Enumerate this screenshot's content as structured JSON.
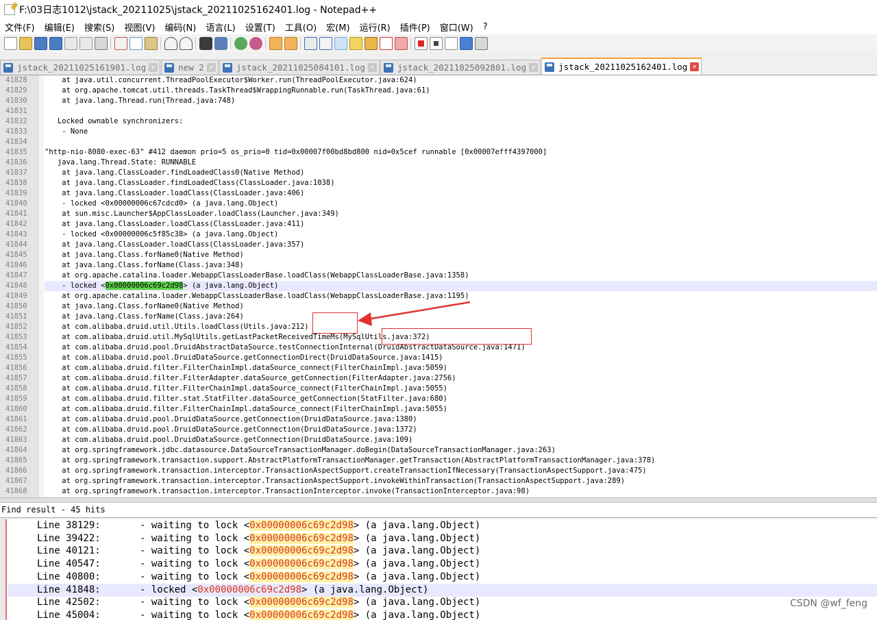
{
  "window": {
    "title": "F:\\03日志1012\\jstack_20211025\\jstack_20211025162401.log - Notepad++"
  },
  "menu": [
    "文件(F)",
    "编辑(E)",
    "搜索(S)",
    "视图(V)",
    "编码(N)",
    "语言(L)",
    "设置(T)",
    "工具(O)",
    "宏(M)",
    "运行(R)",
    "插件(P)",
    "窗口(W)",
    "?"
  ],
  "toolbar": [
    "new-file-icon",
    "open-file-icon",
    "save-icon",
    "save-all-icon",
    "close-icon",
    "close-all-icon",
    "print-icon",
    "sep",
    "cut-icon",
    "copy-icon",
    "paste-icon",
    "sep",
    "undo-icon",
    "redo-icon",
    "sep",
    "find-icon",
    "replace-icon",
    "sep",
    "zoom-in-icon",
    "zoom-out-icon",
    "sep",
    "sync-vertical-icon",
    "sync-horizontal-icon",
    "sep",
    "word-wrap-icon",
    "show-all-chars-icon",
    "indent-guide-icon",
    "doc-map-icon",
    "function-list-icon",
    "folder-workspace-icon",
    "monitor-icon",
    "sep",
    "record-macro-icon",
    "stop-record-icon",
    "play-macro-icon",
    "run-macro-multiple-icon",
    "save-macro-icon"
  ],
  "tabs": [
    {
      "label": "jstack_20211025161901.log",
      "active": false
    },
    {
      "label": "new 2",
      "active": false
    },
    {
      "label": "jstack_20211025084101.log",
      "active": false
    },
    {
      "label": "jstack_20211025092801.log",
      "active": false
    },
    {
      "label": "jstack_20211025162401.log",
      "active": true
    }
  ],
  "editor": {
    "lines": [
      {
        "n": "41828",
        "t": "    at java.util.concurrent.ThreadPoolExecutor$Worker.run(ThreadPoolExecutor.java:624)"
      },
      {
        "n": "41829",
        "t": "    at org.apache.tomcat.util.threads.TaskThread$WrappingRunnable.run(TaskThread.java:61)"
      },
      {
        "n": "41830",
        "t": "    at java.lang.Thread.run(Thread.java:748)"
      },
      {
        "n": "41831",
        "t": ""
      },
      {
        "n": "41832",
        "t": "   Locked ownable synchronizers:"
      },
      {
        "n": "41833",
        "t": "    - None"
      },
      {
        "n": "41834",
        "t": ""
      },
      {
        "n": "41835",
        "t": "\"http-nio-8080-exec-63\" #412 daemon prio=5 os_prio=0 tid=0x00007f00bd8bd800 nid=0x5cef runnable [0x00007efff4397000]"
      },
      {
        "n": "41836",
        "t": "   java.lang.Thread.State: RUNNABLE"
      },
      {
        "n": "41837",
        "t": "    at java.lang.ClassLoader.findLoadedClass0(Native Method)"
      },
      {
        "n": "41838",
        "t": "    at java.lang.ClassLoader.findLoadedClass(ClassLoader.java:1038)"
      },
      {
        "n": "41839",
        "t": "    at java.lang.ClassLoader.loadClass(ClassLoader.java:406)"
      },
      {
        "n": "41840",
        "t": "    - locked <0x00000006c67cdcd0> (a java.lang.Object)"
      },
      {
        "n": "41841",
        "t": "    at sun.misc.Launcher$AppClassLoader.loadClass(Launcher.java:349)"
      },
      {
        "n": "41842",
        "t": "    at java.lang.ClassLoader.loadClass(ClassLoader.java:411)"
      },
      {
        "n": "41843",
        "t": "    - locked <0x00000006c5f85c38> (a java.lang.Object)"
      },
      {
        "n": "41844",
        "t": "    at java.lang.ClassLoader.loadClass(ClassLoader.java:357)"
      },
      {
        "n": "41845",
        "t": "    at java.lang.Class.forName0(Native Method)"
      },
      {
        "n": "41846",
        "t": "    at java.lang.Class.forName(Class.java:348)"
      },
      {
        "n": "41847",
        "t": "    at org.apache.catalina.loader.WebappClassLoaderBase.loadClass(WebappClassLoaderBase.java:1358)"
      },
      {
        "n": "41848",
        "t_pre": "    - locked <",
        "t_mark": "0x00000006c69c2d98",
        "t_post": "> (a java.lang.Object)",
        "highlight": true
      },
      {
        "n": "41849",
        "t": "    at org.apache.catalina.loader.WebappClassLoaderBase.loadClass(WebappClassLoaderBase.java:1195)"
      },
      {
        "n": "41850",
        "t": "    at java.lang.Class.forName0(Native Method)"
      },
      {
        "n": "41851",
        "t": "    at java.lang.Class.forName(Class.java:264)"
      },
      {
        "n": "41852",
        "t": "    at com.alibaba.druid.util.Utils.loadClass(Utils.java:212)"
      },
      {
        "n": "41853",
        "t": "    at com.alibaba.druid.util.MySqlUtils.getLastPacketReceivedTimeMs(MySqlUtils.java:372)"
      },
      {
        "n": "41854",
        "t": "    at com.alibaba.druid.pool.DruidAbstractDataSource.testConnectionInternal(DruidAbstractDataSource.java:1471)"
      },
      {
        "n": "41855",
        "t": "    at com.alibaba.druid.pool.DruidDataSource.getConnectionDirect(DruidDataSource.java:1415)"
      },
      {
        "n": "41856",
        "t": "    at com.alibaba.druid.filter.FilterChainImpl.dataSource_connect(FilterChainImpl.java:5059)"
      },
      {
        "n": "41857",
        "t": "    at com.alibaba.druid.filter.FilterAdapter.dataSource_getConnection(FilterAdapter.java:2756)"
      },
      {
        "n": "41858",
        "t": "    at com.alibaba.druid.filter.FilterChainImpl.dataSource_connect(FilterChainImpl.java:5055)"
      },
      {
        "n": "41859",
        "t": "    at com.alibaba.druid.filter.stat.StatFilter.dataSource_getConnection(StatFilter.java:680)"
      },
      {
        "n": "41860",
        "t": "    at com.alibaba.druid.filter.FilterChainImpl.dataSource_connect(FilterChainImpl.java:5055)"
      },
      {
        "n": "41861",
        "t": "    at com.alibaba.druid.pool.DruidDataSource.getConnection(DruidDataSource.java:1380)"
      },
      {
        "n": "41862",
        "t": "    at com.alibaba.druid.pool.DruidDataSource.getConnection(DruidDataSource.java:1372)"
      },
      {
        "n": "41863",
        "t": "    at com.alibaba.druid.pool.DruidDataSource.getConnection(DruidDataSource.java:109)"
      },
      {
        "n": "41864",
        "t": "    at org.springframework.jdbc.datasource.DataSourceTransactionManager.doBegin(DataSourceTransactionManager.java:263)"
      },
      {
        "n": "41865",
        "t": "    at org.springframework.transaction.support.AbstractPlatformTransactionManager.getTransaction(AbstractPlatformTransactionManager.java:378)"
      },
      {
        "n": "41866",
        "t": "    at org.springframework.transaction.interceptor.TransactionAspectSupport.createTransactionIfNecessary(TransactionAspectSupport.java:475)"
      },
      {
        "n": "41867",
        "t": "    at org.springframework.transaction.interceptor.TransactionAspectSupport.invokeWithinTransaction(TransactionAspectSupport.java:289)"
      },
      {
        "n": "41868",
        "t": "    at org.springframework.transaction.interceptor.TransactionInterceptor.invoke(TransactionInterceptor.java:98)"
      }
    ]
  },
  "find_result": {
    "header": "Find result - 45 hits",
    "rows": [
      {
        "line": "Line 38129:",
        "pre": "- waiting to lock <",
        "addr": "0x00000006c69c2d98",
        "post": "> (a java.lang.Object)",
        "selected": false
      },
      {
        "line": "Line 39422:",
        "pre": "- waiting to lock <",
        "addr": "0x00000006c69c2d98",
        "post": "> (a java.lang.Object)",
        "selected": false
      },
      {
        "line": "Line 40121:",
        "pre": "- waiting to lock <",
        "addr": "0x00000006c69c2d98",
        "post": "> (a java.lang.Object)",
        "selected": false
      },
      {
        "line": "Line 40547:",
        "pre": "- waiting to lock <",
        "addr": "0x00000006c69c2d98",
        "post": "> (a java.lang.Object)",
        "selected": false
      },
      {
        "line": "Line 40800:",
        "pre": "- waiting to lock <",
        "addr": "0x00000006c69c2d98",
        "post": "> (a java.lang.Object)",
        "selected": false
      },
      {
        "line": "Line 41848:",
        "pre": "- locked <",
        "addr": "0x00000006c69c2d98",
        "post": "> (a java.lang.Object)",
        "selected": true
      },
      {
        "line": "Line 42502:",
        "pre": "- waiting to lock <",
        "addr": "0x00000006c69c2d98",
        "post": "> (a java.lang.Object)",
        "selected": false
      },
      {
        "line": "Line 45004:",
        "pre": "- waiting to lock <",
        "addr": "0x00000006c69c2d98",
        "post": "> (a java.lang.Object)",
        "selected": false
      }
    ]
  },
  "watermark": "CSDN @wf_feng",
  "colors": {
    "accent_tab": "#fa9e38",
    "match_text": "#d7371b",
    "match_bg": "#fff2a8",
    "annotation": "#e03131",
    "line_highlight": "#e8e8ff",
    "green_mark": "#5bd246"
  }
}
